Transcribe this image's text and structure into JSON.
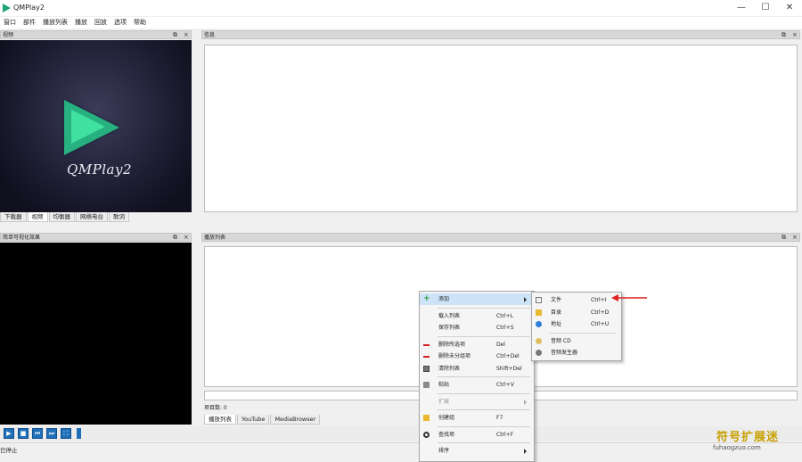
{
  "window": {
    "title": "QMPlay2",
    "minimize": "—",
    "maximize": "☐",
    "close": "✕"
  },
  "menubar": [
    "窗口",
    "部件",
    "播放列表",
    "播放",
    "回放",
    "选项",
    "帮助"
  ],
  "video_dock": {
    "title": "视频",
    "logo_text": "QMPlay2"
  },
  "left_tabs": [
    "下载器",
    "视频",
    "均衡器",
    "网络电台",
    "歌词"
  ],
  "left_tab_active": 1,
  "viz_dock": {
    "title": "简单可视化效果"
  },
  "info_dock": {
    "title": "信息"
  },
  "playlist_dock": {
    "title": "播放列表",
    "entries_label": "项目数: 0"
  },
  "bottom_tabs": [
    "播放列表",
    "YouTube",
    "MediaBrowser"
  ],
  "bottom_tab_active": 0,
  "status": {
    "text": "已停止"
  },
  "dock_controls": {
    "float": "⧉",
    "close": "×"
  },
  "context_menu": {
    "items": [
      {
        "label": "添加",
        "shortcut": "",
        "icon": "add-icon",
        "submenu": true,
        "selected": true,
        "disabled": false
      },
      {
        "separator": true
      },
      {
        "label": "载入列表",
        "shortcut": "Ctrl+L",
        "icon": "",
        "submenu": false,
        "selected": false,
        "disabled": false
      },
      {
        "label": "保存列表",
        "shortcut": "Ctrl+S",
        "icon": "",
        "submenu": false,
        "selected": false,
        "disabled": false
      },
      {
        "separator": true
      },
      {
        "label": "删除所选项",
        "shortcut": "Del",
        "icon": "remove-icon",
        "submenu": false,
        "selected": false,
        "disabled": false
      },
      {
        "label": "删除未分组项",
        "shortcut": "Ctrl+Del",
        "icon": "remove-icon",
        "submenu": false,
        "selected": false,
        "disabled": false
      },
      {
        "label": "清除列表",
        "shortcut": "Shift+Del",
        "icon": "clear-list-icon",
        "submenu": false,
        "selected": false,
        "disabled": false
      },
      {
        "separator": true
      },
      {
        "label": "粘贴",
        "shortcut": "Ctrl+V",
        "icon": "paste-icon",
        "submenu": false,
        "selected": false,
        "disabled": false
      },
      {
        "separator": true
      },
      {
        "label": "扩展",
        "shortcut": "",
        "icon": "",
        "submenu": true,
        "selected": false,
        "disabled": true
      },
      {
        "separator": true
      },
      {
        "label": "创建组",
        "shortcut": "F7",
        "icon": "folder-new-icon",
        "submenu": false,
        "selected": false,
        "disabled": false
      },
      {
        "separator": true
      },
      {
        "label": "查找项",
        "shortcut": "Ctrl+F",
        "icon": "search-icon",
        "submenu": false,
        "selected": false,
        "disabled": false
      },
      {
        "separator": true
      },
      {
        "label": "排序",
        "shortcut": "",
        "icon": "",
        "submenu": true,
        "selected": false,
        "disabled": false
      }
    ]
  },
  "submenu": {
    "items": [
      {
        "label": "文件",
        "shortcut": "Ctrl+I",
        "icon": "file-icon"
      },
      {
        "label": "目录",
        "shortcut": "Ctrl+D",
        "icon": "folder-icon"
      },
      {
        "label": "地址",
        "shortcut": "Ctrl+U",
        "icon": "globe-icon"
      },
      {
        "separator": true
      },
      {
        "label": "音频 CD",
        "shortcut": "",
        "icon": "cd-icon"
      },
      {
        "label": "音频发生器",
        "shortcut": "",
        "icon": "audio-generator-icon"
      }
    ]
  },
  "watermark": {
    "line1": "符号扩展迷",
    "line2": "fuhaogzuo.com"
  },
  "colors": {
    "accent": "#1f6fb8",
    "arrow": "#e02020",
    "logo": "#27b080"
  }
}
